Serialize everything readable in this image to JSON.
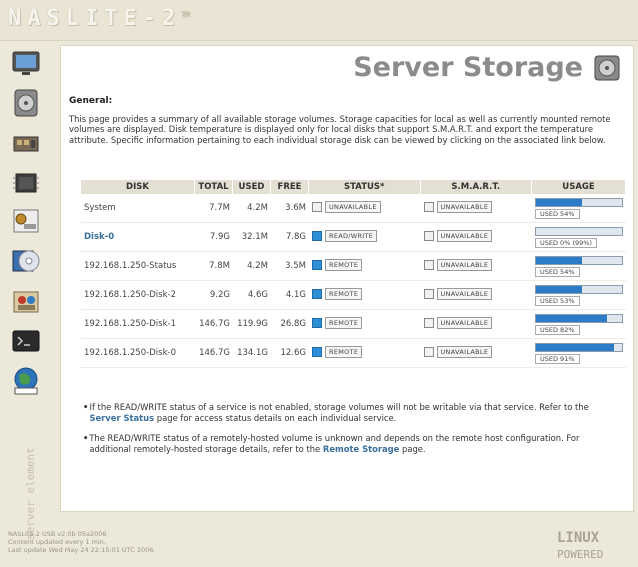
{
  "brand": {
    "logo_text": "NASLITE-2",
    "trademark": "TM"
  },
  "page": {
    "title": "Server Storage"
  },
  "general": {
    "label": "General:",
    "description": "This page provides a summary of all available storage volumes. Storage capacities for local as well as currently mounted remote volumes are displayed. Disk temperature is displayed only for local disks that support S.M.A.R.T. and export the temperature attribute. Specific information pertaining to each individual storage disk can be viewed by clicking on the associated link below."
  },
  "table": {
    "headers": [
      "DISK",
      "TOTAL",
      "USED",
      "FREE",
      "STATUS*",
      "S.M.A.R.T.",
      "USAGE"
    ],
    "rows": [
      {
        "disk": "System",
        "total": "7.7M",
        "used": "4.2M",
        "free": "3.6M",
        "status": "UNAVAILABLE",
        "status_active": false,
        "smart": "UNAVAILABLE",
        "usage_label": "USED 54%",
        "usage_pct": 0.54,
        "link": false
      },
      {
        "disk": "Disk-0",
        "total": "7.9G",
        "used": "32.1M",
        "free": "7.8G",
        "status": "READ/WRITE",
        "status_active": true,
        "smart": "UNAVAILABLE",
        "usage_label": "USED 0% (99%)",
        "usage_pct": 0.0,
        "link": true
      },
      {
        "disk": "192.168.1.250-Status",
        "total": "7.8M",
        "used": "4.2M",
        "free": "3.5M",
        "status": "REMOTE",
        "status_active": true,
        "smart": "UNAVAILABLE",
        "usage_label": "USED 54%",
        "usage_pct": 0.54,
        "link": false
      },
      {
        "disk": "192.168.1.250-Disk-2",
        "total": "9.2G",
        "used": "4.6G",
        "free": "4.1G",
        "status": "REMOTE",
        "status_active": true,
        "smart": "UNAVAILABLE",
        "usage_label": "USED 53%",
        "usage_pct": 0.53,
        "link": false
      },
      {
        "disk": "192.168.1.250-Disk-1",
        "total": "146.7G",
        "used": "119.9G",
        "free": "26.8G",
        "status": "REMOTE",
        "status_active": true,
        "smart": "UNAVAILABLE",
        "usage_label": "USED 82%",
        "usage_pct": 0.82,
        "link": false
      },
      {
        "disk": "192.168.1.250-Disk-0",
        "total": "146.7G",
        "used": "134.1G",
        "free": "12.6G",
        "status": "REMOTE",
        "status_active": true,
        "smart": "UNAVAILABLE",
        "usage_label": "USED 91%",
        "usage_pct": 0.91,
        "link": false
      }
    ]
  },
  "notes": [
    {
      "pre": "If the READ/WRITE status of a service is not enabled, storage volumes will not be writable via that service. Refer to the ",
      "link": "Server Status",
      "post": " page for access status details on each individual service."
    },
    {
      "pre": "The READ/WRITE status of a remotely-hosted volume is unknown and depends on the remote host configuration. For additional remotely-hosted storage details, refer to the ",
      "link": "Remote Storage",
      "post": " page."
    }
  ],
  "footer": {
    "line1": "NASLite-2 USB v2.0b 05a2006",
    "line2": "Content updated every 1 min.",
    "line3": "Last update Wed May 24 22:15:01 UTC 2006."
  },
  "linux": {
    "line1": "LINUX",
    "line2": "POWERED"
  },
  "sidebar": {
    "vertical_brand": "server elements"
  },
  "colors": {
    "accent": "#2b7bc6",
    "link": "#3a6f9e",
    "title": "#8b8b8b",
    "header_bg": "#e3dfd2"
  }
}
